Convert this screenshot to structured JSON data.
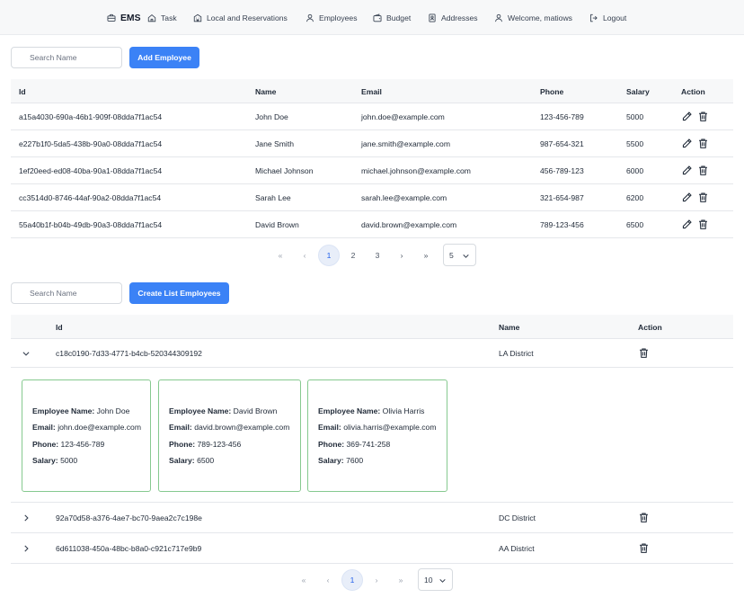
{
  "nav": {
    "brand": "EMS",
    "items": [
      "Task",
      "Local and Reservations",
      "Employees",
      "Budget",
      "Addresses",
      "Welcome, matiows",
      "Logout"
    ]
  },
  "employees": {
    "search_placeholder": "Search Name",
    "add_button": "Add Employee",
    "columns": [
      "Id",
      "Name",
      "Email",
      "Phone",
      "Salary",
      "Action"
    ],
    "rows": [
      [
        "a15a4030-690a-46b1-909f-08dda7f1ac54",
        "John Doe",
        "john.doe@example.com",
        "123-456-789",
        "5000"
      ],
      [
        "e227b1f0-5da5-438b-90a0-08dda7f1ac54",
        "Jane Smith",
        "jane.smith@example.com",
        "987-654-321",
        "5500"
      ],
      [
        "1ef20eed-ed08-40ba-90a1-08dda7f1ac54",
        "Michael Johnson",
        "michael.johnson@example.com",
        "456-789-123",
        "6000"
      ],
      [
        "cc3514d0-8746-44af-90a2-08dda7f1ac54",
        "Sarah Lee",
        "sarah.lee@example.com",
        "321-654-987",
        "6200"
      ],
      [
        "55a40b1f-b04b-49db-90a3-08dda7f1ac54",
        "David Brown",
        "david.brown@example.com",
        "789-123-456",
        "6500"
      ]
    ],
    "pagination": {
      "first": "«",
      "prev": "‹",
      "pages": [
        "1",
        "2",
        "3"
      ],
      "active": "1",
      "next": "›",
      "last": "»",
      "page_size": "5"
    }
  },
  "lists": {
    "search_placeholder": "Search Name",
    "create_button": "Create List Employees",
    "columns": [
      "Id",
      "Name",
      "Action"
    ],
    "rows": [
      {
        "id": "c18c0190-7d33-4771-b4cb-520344309192",
        "name": "LA District",
        "expanded": true
      },
      {
        "id": "92a70d58-a376-4ae7-bc70-9aea2c7c198e",
        "name": "DC District",
        "expanded": false
      },
      {
        "id": "6d611038-450a-48bc-b8a0-c921c717e9b9",
        "name": "AA District",
        "expanded": false
      }
    ],
    "card_labels": {
      "name": "Employee Name:",
      "email": "Email:",
      "phone": "Phone:",
      "salary": "Salary:"
    },
    "cards": [
      {
        "name": "John Doe",
        "email": "john.doe@example.com",
        "phone": "123-456-789",
        "salary": "5000"
      },
      {
        "name": "David Brown",
        "email": "david.brown@example.com",
        "phone": "789-123-456",
        "salary": "6500"
      },
      {
        "name": "Olivia Harris",
        "email": "olivia.harris@example.com",
        "phone": "369-741-258",
        "salary": "7600"
      }
    ],
    "pagination": {
      "first": "«",
      "prev": "‹",
      "pages": [
        "1"
      ],
      "active": "1",
      "next": "›",
      "last": "»",
      "page_size": "10"
    }
  },
  "colors": {
    "primary": "#3b82f6",
    "card_border": "#86c98f",
    "header_bg": "#f7f8f9"
  }
}
